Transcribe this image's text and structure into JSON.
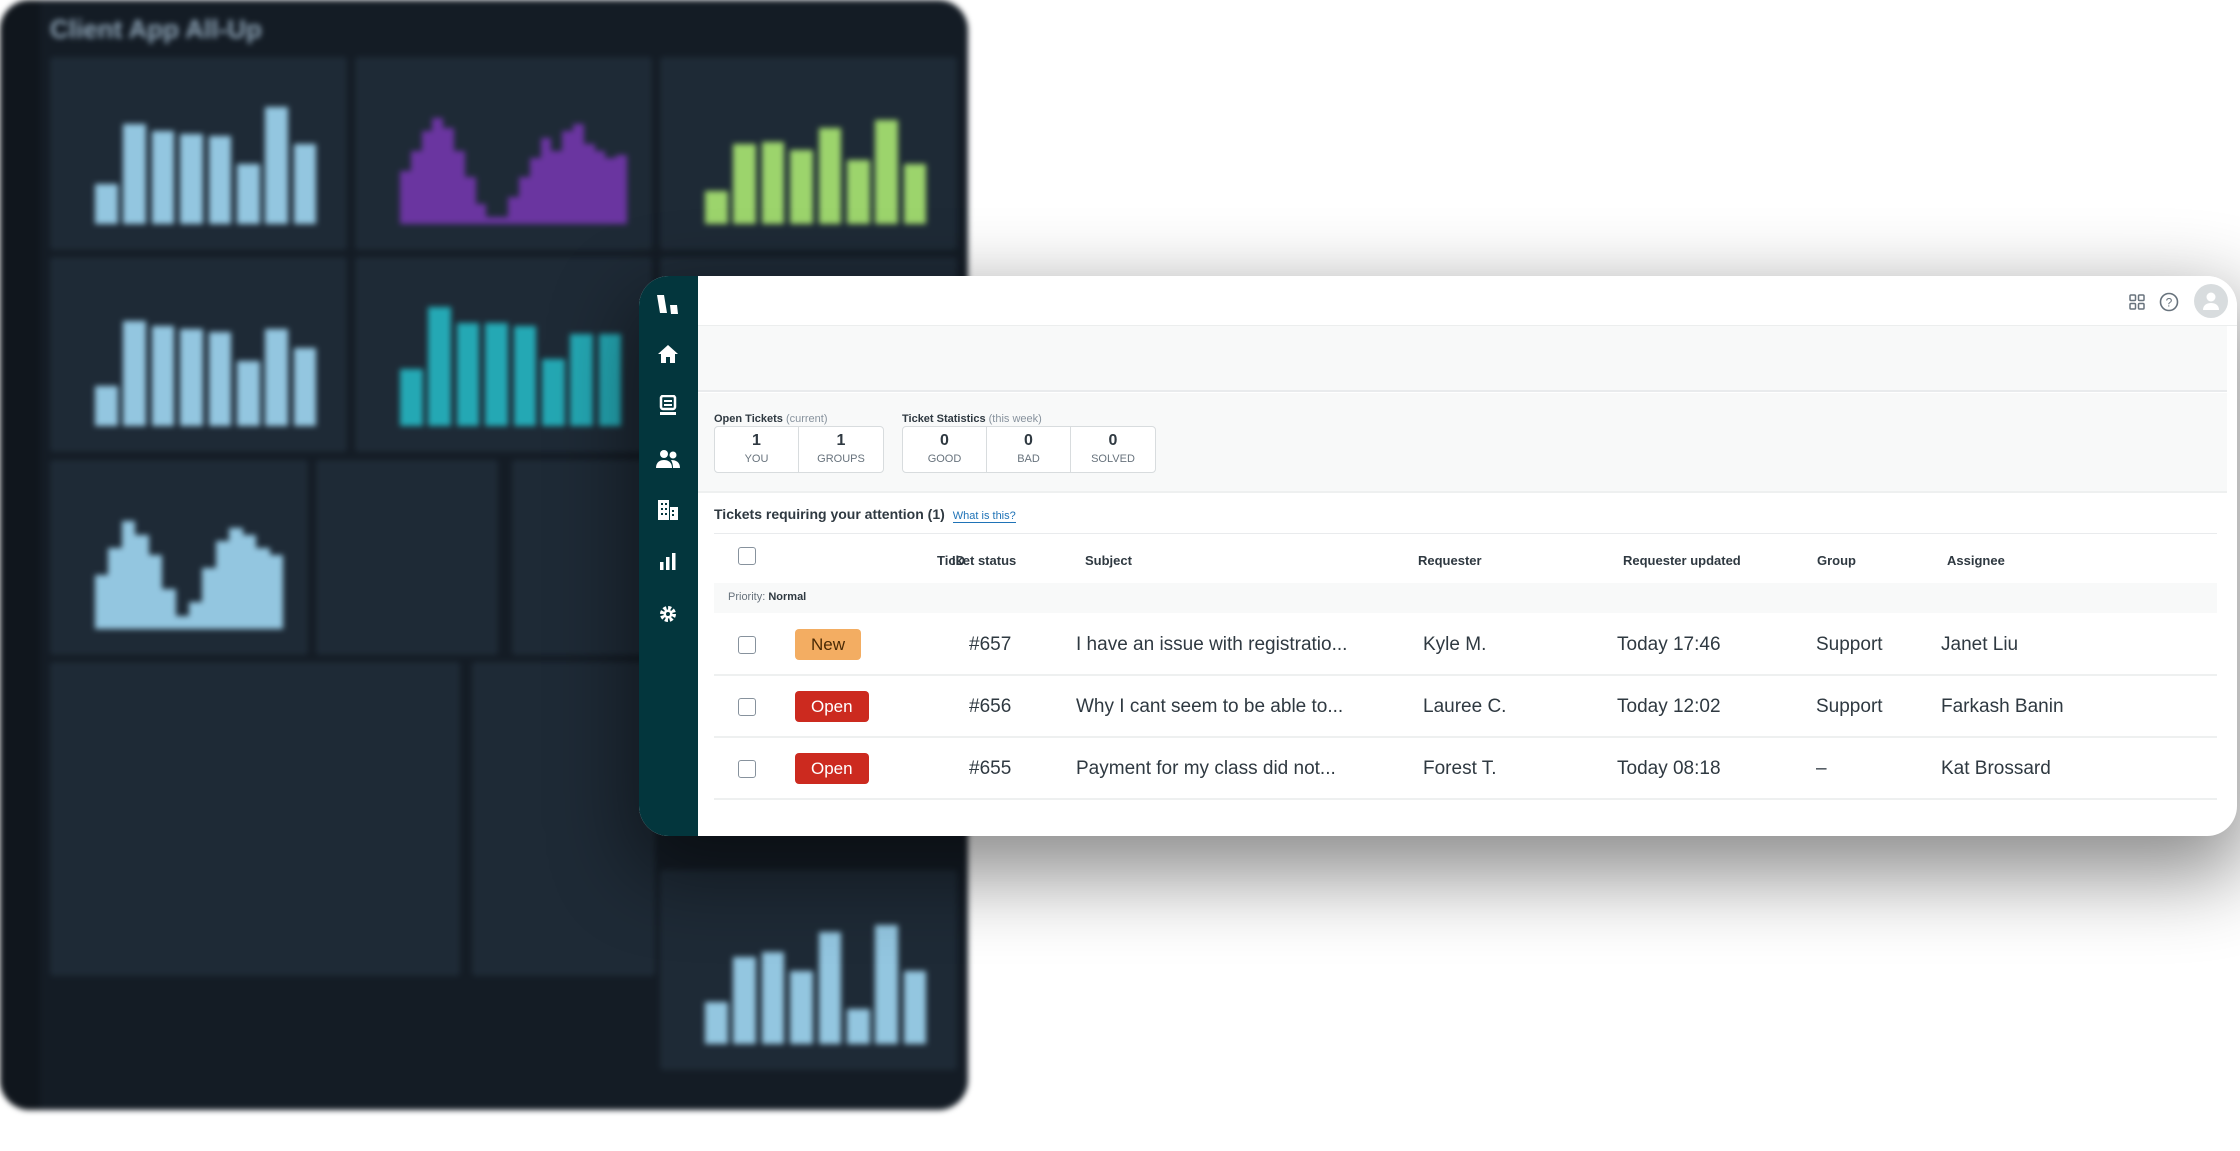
{
  "background_dashboard": {
    "title": "Client App All-Up",
    "panels": [
      {
        "color": "#93c6e0",
        "bars": [
          30,
          75,
          70,
          68,
          66,
          45,
          88,
          60
        ]
      },
      {
        "color": "#6a35a0",
        "bars": [
          40,
          55,
          70,
          80,
          72,
          55,
          35,
          15,
          5,
          5,
          20,
          35,
          50,
          65,
          55,
          70,
          75,
          60,
          55,
          50,
          52
        ]
      },
      {
        "color": "#9cd46c",
        "bars": [
          25,
          60,
          62,
          56,
          72,
          48,
          78,
          45
        ]
      },
      {
        "color": "#93c6e0",
        "bars": [
          30,
          78,
          74,
          72,
          70,
          48,
          72,
          58
        ]
      },
      {
        "color": "#24a8b4",
        "bars": [
          42,
          88,
          76,
          76,
          74,
          50,
          68,
          68
        ]
      },
      {
        "color": "#93c6e0",
        "bars": [
          40,
          60,
          80,
          70,
          55,
          30,
          10,
          20,
          45,
          65,
          75,
          70,
          60,
          55
        ]
      },
      {
        "color": "#93c6e0",
        "bars": [
          30,
          62,
          66,
          52,
          80,
          25,
          85,
          52
        ]
      }
    ]
  },
  "sidebar": {
    "items": [
      "logo-icon",
      "home-icon",
      "views-icon",
      "customers-icon",
      "organizations-icon",
      "reporting-icon",
      "admin-gear-icon"
    ]
  },
  "header": {
    "icons": [
      "apps-grid-icon",
      "help-icon",
      "user-avatar-icon"
    ]
  },
  "open_tickets": {
    "label": "Open Tickets",
    "qualifier": "(current)",
    "boxes": [
      {
        "value": "1",
        "label": "YOU"
      },
      {
        "value": "1",
        "label": "GROUPS"
      }
    ]
  },
  "ticket_statistics": {
    "label": "Ticket Statistics",
    "qualifier": "(this week)",
    "boxes": [
      {
        "value": "0",
        "label": "GOOD"
      },
      {
        "value": "0",
        "label": "BAD"
      },
      {
        "value": "0",
        "label": "SOLVED"
      }
    ]
  },
  "attention": {
    "title": "Tickets requiring your attention (1)",
    "link": "What is this?"
  },
  "table": {
    "columns": [
      "Ticket status",
      "ID",
      "Subject",
      "Requester",
      "Requester updated",
      "Group",
      "Assignee"
    ],
    "priority_label": "Priority:",
    "priority_value": "Normal",
    "rows": [
      {
        "status": "New",
        "status_color": "#f3ad62",
        "id": "#657",
        "subject": "I have an issue with registratio...",
        "requester": "Kyle M.",
        "updated": "Today 17:46",
        "group": "Support",
        "assignee": "Janet Liu"
      },
      {
        "status": "Open",
        "status_color": "#cc2a1f",
        "id": "#656",
        "subject": "Why I cant seem to be able to...",
        "requester": "Lauree C.",
        "updated": "Today 12:02",
        "group": "Support",
        "assignee": "Farkash Banin"
      },
      {
        "status": "Open",
        "status_color": "#cc2a1f",
        "id": "#655",
        "subject": "Payment for my class did not...",
        "requester": "Forest T.",
        "updated": "Today 08:18",
        "group": "–",
        "assignee": "Kat Brossard"
      }
    ]
  }
}
